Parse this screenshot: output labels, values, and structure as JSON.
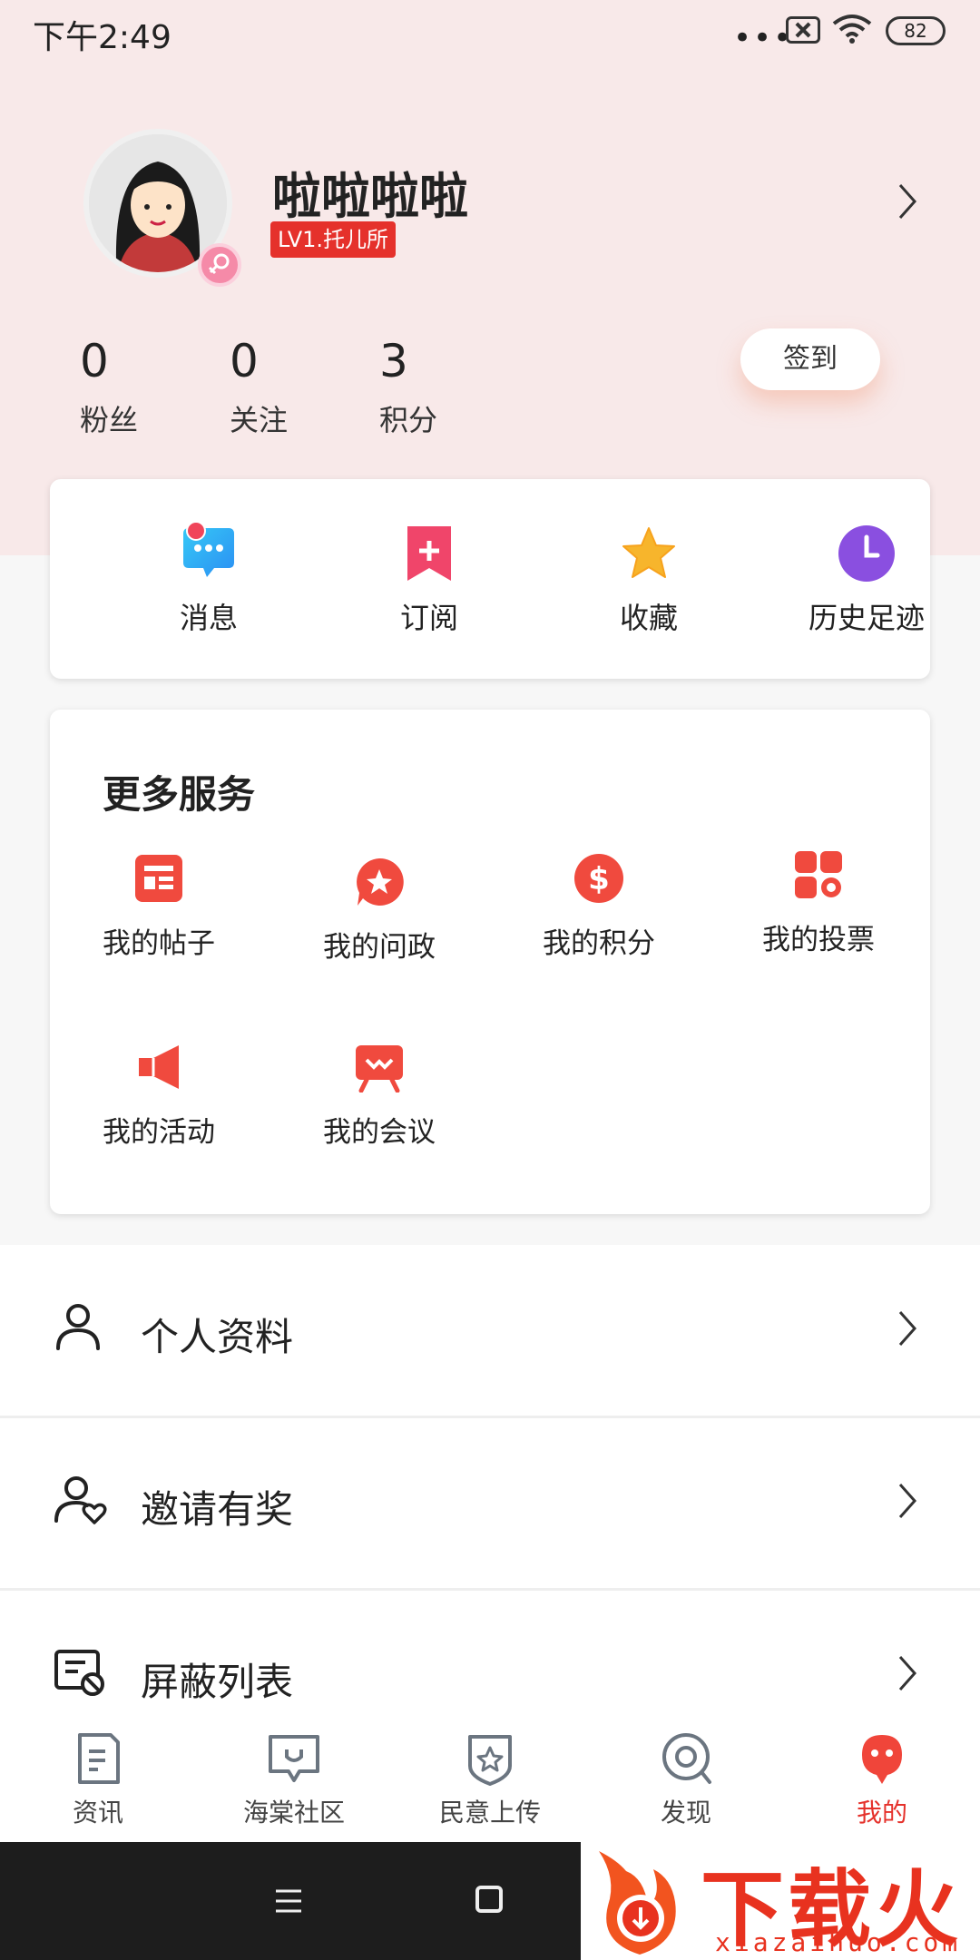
{
  "status_bar": {
    "time": "下午2:49",
    "dots": "•••",
    "battery": "82"
  },
  "profile": {
    "name": "啦啦啦啦",
    "level": "LV1.托儿所",
    "stats": [
      {
        "value": "0",
        "label": "粉丝"
      },
      {
        "value": "0",
        "label": "关注"
      },
      {
        "value": "3",
        "label": "积分"
      }
    ],
    "checkin_label": "签到"
  },
  "quick_actions": [
    {
      "label": "消息",
      "icon": "message-icon"
    },
    {
      "label": "订阅",
      "icon": "subscribe-icon"
    },
    {
      "label": "收藏",
      "icon": "star-icon"
    },
    {
      "label": "历史足迹",
      "icon": "clock-icon"
    }
  ],
  "services": {
    "title": "更多服务",
    "items": [
      {
        "label": "我的帖子",
        "icon": "posts-icon"
      },
      {
        "label": "我的问政",
        "icon": "inquiry-icon"
      },
      {
        "label": "我的积分",
        "icon": "points-icon"
      },
      {
        "label": "我的投票",
        "icon": "vote-icon"
      },
      {
        "label": "我的活动",
        "icon": "activity-icon"
      },
      {
        "label": "我的会议",
        "icon": "meeting-icon"
      }
    ]
  },
  "menu": [
    {
      "label": "个人资料",
      "icon": "person-icon"
    },
    {
      "label": "邀请有奖",
      "icon": "invite-icon"
    },
    {
      "label": "屏蔽列表",
      "icon": "block-list-icon"
    }
  ],
  "bottom_nav": [
    {
      "label": "资讯",
      "icon": "news-icon",
      "active": false
    },
    {
      "label": "海棠社区",
      "icon": "community-icon",
      "active": false
    },
    {
      "label": "民意上传",
      "icon": "upload-icon",
      "active": false
    },
    {
      "label": "发现",
      "icon": "discover-icon",
      "active": false
    },
    {
      "label": "我的",
      "icon": "mine-icon",
      "active": true
    }
  ],
  "watermark": {
    "text": "下载火",
    "sub": "xiazaihuo.com"
  },
  "colors": {
    "accent": "#e5312b",
    "header_bg": "#f8e9e9",
    "purple": "#8a4fe0",
    "blue": "#2fa0f5"
  }
}
